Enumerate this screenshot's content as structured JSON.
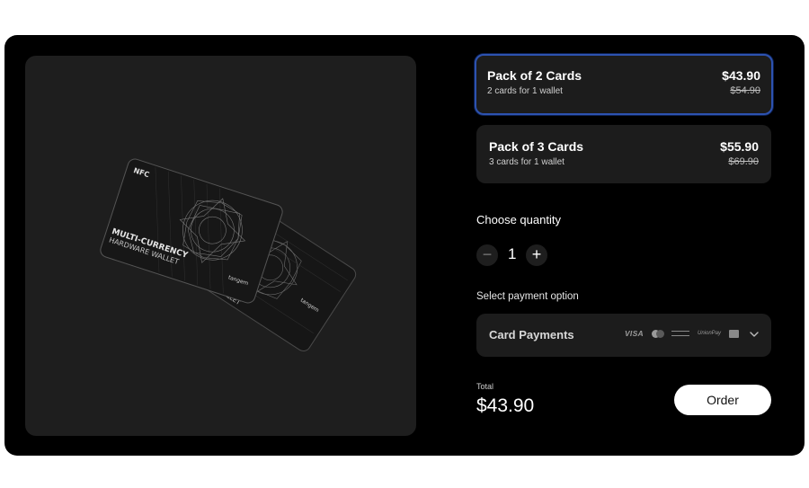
{
  "product": {
    "image_alt": "Multi-currency hardware wallet NFC cards"
  },
  "cards": {
    "nfc_label": "NFC",
    "line1": "MULTI-CURRENCY",
    "line2": "HARDWARE WALLET",
    "brand": "tangem"
  },
  "options": [
    {
      "title": "Pack of 2 Cards",
      "subtitle": "2 cards for 1 wallet",
      "price": "$43.90",
      "old_price": "$54.90",
      "selected": true
    },
    {
      "title": "Pack of 3 Cards",
      "subtitle": "3 cards for 1 wallet",
      "price": "$55.90",
      "old_price": "$69.90",
      "selected": false
    }
  ],
  "quantity": {
    "label": "Choose quantity",
    "value": "1",
    "minus": "−",
    "plus": "+"
  },
  "payment": {
    "label": "Select payment option",
    "selected": "Card Payments",
    "icons": [
      "visa-icon",
      "mastercard-icon",
      "amex-icon",
      "unionpay-icon",
      "jcb-icon"
    ],
    "visa_text": "VISA",
    "unionpay_text": "UnionPay"
  },
  "total": {
    "label": "Total",
    "value": "$43.90"
  },
  "order_button": "Order",
  "colors": {
    "accent_border": "#2d52b0",
    "background": "#000000",
    "panel": "#1c1c1c"
  }
}
